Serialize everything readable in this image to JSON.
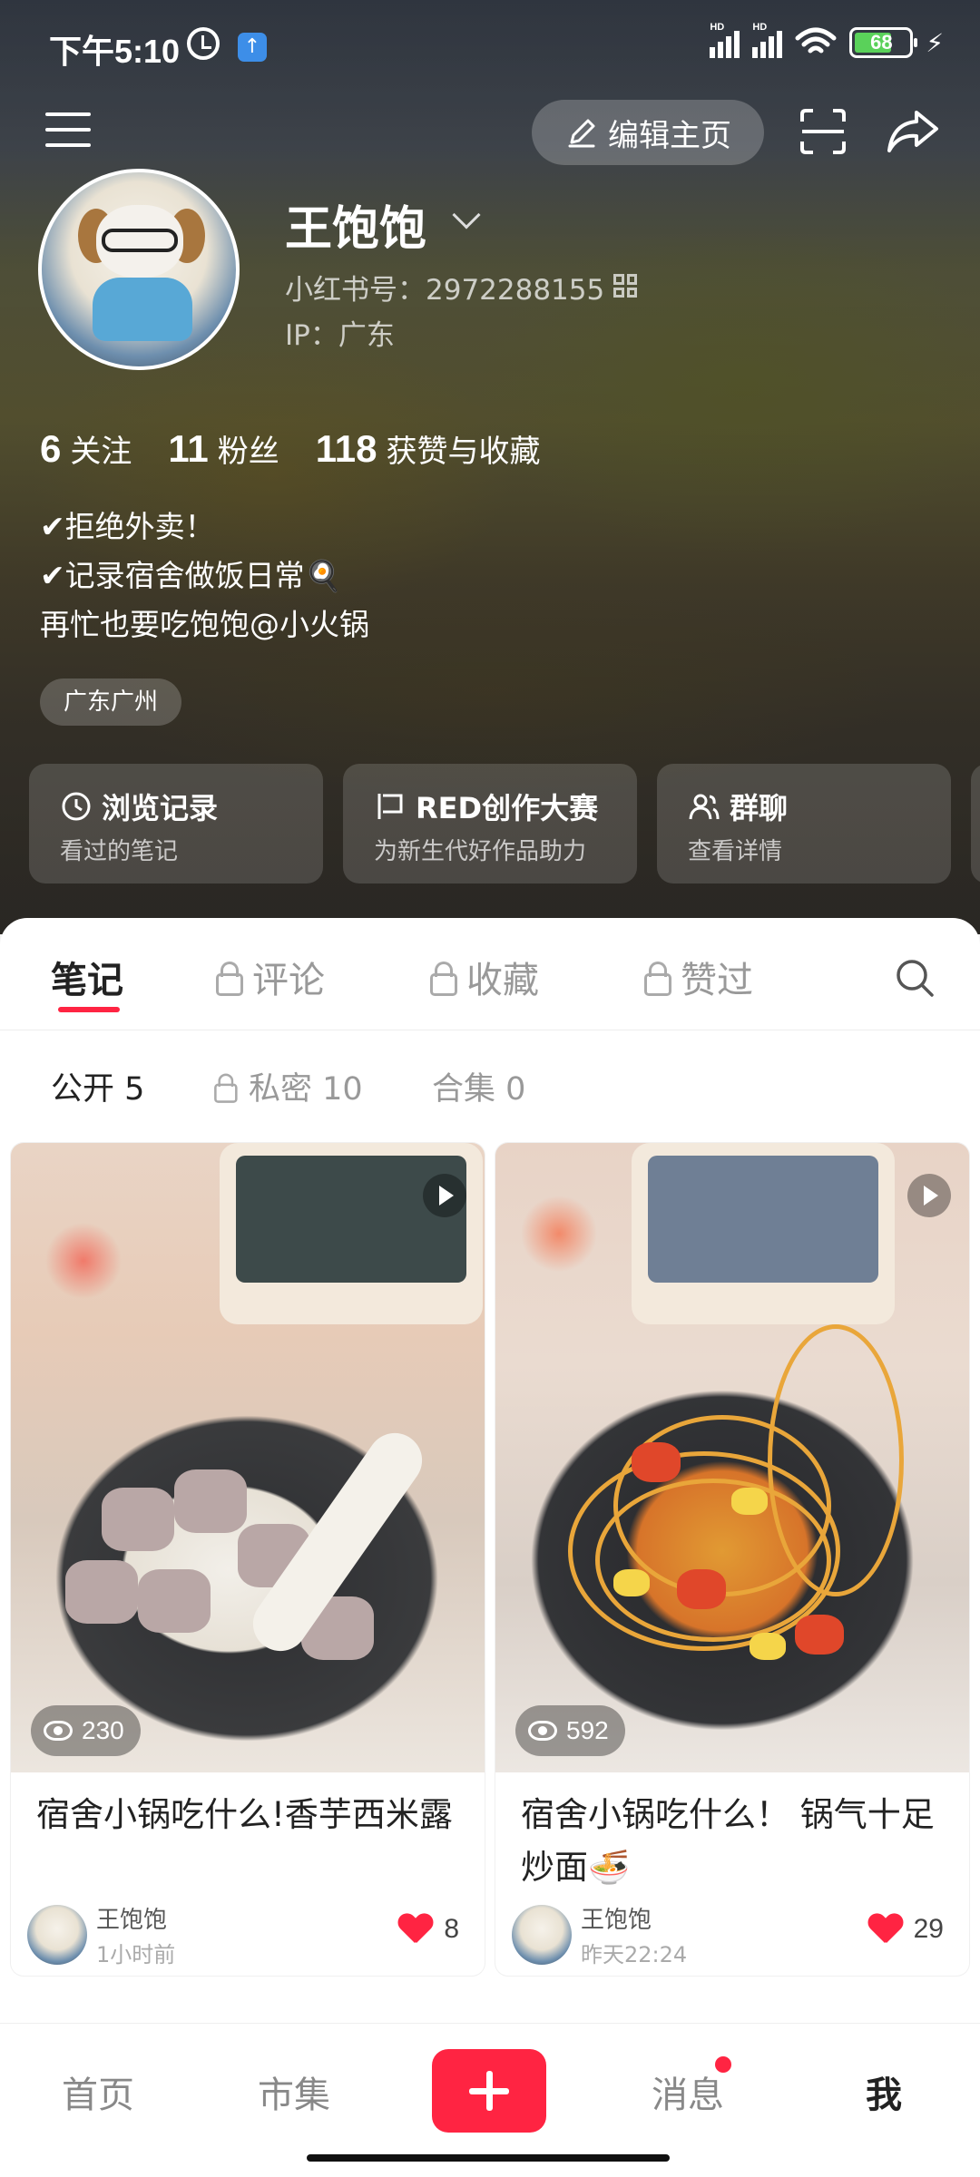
{
  "status_bar": {
    "time": "下午5:10",
    "battery": "68",
    "signal_label": "HD"
  },
  "top_bar": {
    "edit_label": "编辑主页"
  },
  "profile": {
    "name": "王饱饱",
    "red_id": "小红书号：2972288155",
    "ip": "IP：广东",
    "stats": [
      {
        "num": "6",
        "label": "关注"
      },
      {
        "num": "11",
        "label": "粉丝"
      },
      {
        "num": "118",
        "label": "获赞与收藏"
      }
    ],
    "bio": [
      "✔拒绝外卖！",
      "✔记录宿舍做饭日常🍳",
      "再忙也要吃饱饱@小火锅"
    ],
    "location_tag": "广东广州"
  },
  "quick_cards": [
    {
      "title": "浏览记录",
      "subtitle": "看过的笔记",
      "icon": "clock-icon"
    },
    {
      "title": "RED创作大赛",
      "subtitle": "为新生代好作品助力",
      "icon": "flag-icon"
    },
    {
      "title": "群聊",
      "subtitle": "查看详情",
      "icon": "group-icon"
    }
  ],
  "tabs": [
    {
      "label": "笔记",
      "active": true
    },
    {
      "label": "评论",
      "locked": true
    },
    {
      "label": "收藏",
      "locked": true
    },
    {
      "label": "赞过",
      "locked": true
    }
  ],
  "subtabs": [
    {
      "label": "公开 5",
      "active": true
    },
    {
      "label": "私密 10",
      "locked": true
    },
    {
      "label": "合集 0"
    }
  ],
  "notes": [
    {
      "title": "宿舍小锅吃什么!香芋西米露",
      "views": "230",
      "author": "王饱饱",
      "time": "1小时前",
      "likes": "8"
    },
    {
      "title": "宿舍小锅吃什么！ 锅气十足炒面🍜",
      "views": "592",
      "author": "王饱饱",
      "time": "昨天22:24",
      "likes": "29"
    }
  ],
  "bottom_nav": {
    "home": "首页",
    "market": "市集",
    "messages": "消息",
    "me": "我"
  },
  "colors": {
    "accent": "#ff2442"
  }
}
